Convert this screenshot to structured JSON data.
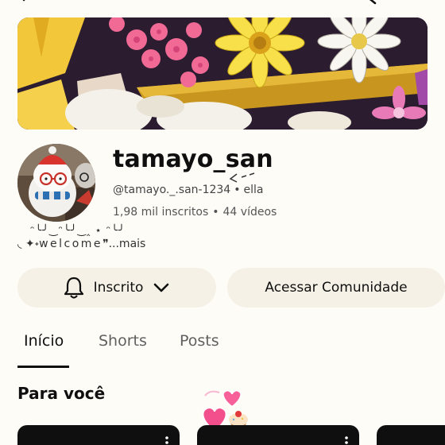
{
  "channel": {
    "name": "tamayo_san",
    "handle": "@tamayo._.san-1234",
    "pronouns": "ella",
    "separator": "•",
    "subscribers": "1,98 mil inscritos",
    "videos": "44 vídeos",
    "bio_decoration": "ᵔ╰╯‿ᵔ╰╯‿‸ ⋆ ᵔ╰╯",
    "bio_prefix": "◟ ✦˖",
    "bio_text": "welcome",
    "bio_suffix": "❞",
    "more_label": "...mais"
  },
  "actions": {
    "subscribed_label": "Inscrito",
    "community_label": "Acessar Comunidade"
  },
  "tabs": [
    {
      "label": "Início",
      "active": true
    },
    {
      "label": "Shorts",
      "active": false
    },
    {
      "label": "Posts",
      "active": false
    }
  ],
  "section": {
    "title": "Para você"
  },
  "icons": {
    "bell": "bell-icon",
    "chevron": "chevron-down-icon",
    "more": "more-vertical-icon"
  },
  "colors": {
    "background": "#fefcf7",
    "button_bg": "#f6f1e7",
    "text": "#0f0f0f",
    "muted": "#606060"
  }
}
